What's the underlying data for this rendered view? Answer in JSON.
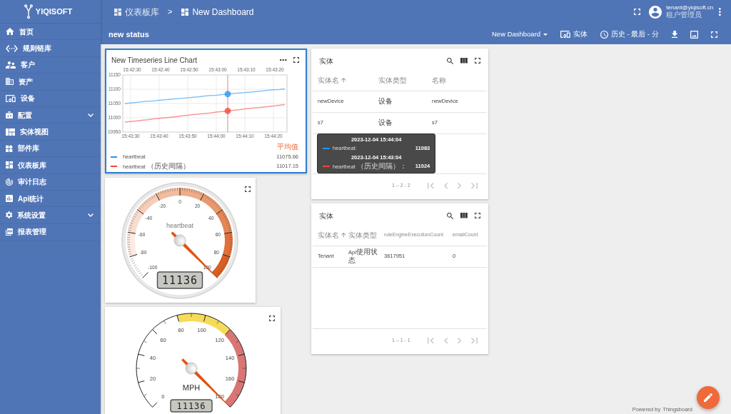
{
  "sidebar": {
    "logo": "YIQISOFT",
    "items": [
      {
        "label": "首页",
        "has_submenu": false
      },
      {
        "label": "规则链库",
        "has_submenu": false
      },
      {
        "label": "客户",
        "has_submenu": false
      },
      {
        "label": "资产",
        "has_submenu": false
      },
      {
        "label": "设备",
        "has_submenu": false
      },
      {
        "label": "配置",
        "has_submenu": true
      },
      {
        "label": "实体视图",
        "has_submenu": false
      },
      {
        "label": "部件库",
        "has_submenu": false
      },
      {
        "label": "仪表板库",
        "has_submenu": false
      },
      {
        "label": "审计日志",
        "has_submenu": false
      },
      {
        "label": "Api统计",
        "has_submenu": false
      },
      {
        "label": "系统设置",
        "has_submenu": true
      },
      {
        "label": "报表管理",
        "has_submenu": false
      }
    ]
  },
  "topbar": {
    "breadcrumb": [
      {
        "label": "仪表板库"
      },
      {
        "label": "New Dashboard"
      }
    ],
    "separator": ">",
    "user": {
      "email": "tenant@yiqisoft.cn",
      "role": "租户管理员"
    }
  },
  "toolbar": {
    "title": "new status",
    "dashboard_select": "New Dashboard",
    "entities_button": "实体",
    "timewindow": "历史 - 最后 - 分"
  },
  "columns": [
    {
      "widgets": [
        {
          "kind": "timeseries_chart",
          "selected": true,
          "title": "New Timeseries Line Chart",
          "top_axis_labels": [
            "15:42:30",
            "15:42:40",
            "15:42:50",
            "15:43:00",
            "15:43:10",
            "15:43:20"
          ],
          "chart_data": {
            "type": "line",
            "grid": true,
            "categories": [
              null,
              "15:43:30",
              null,
              null,
              null,
              null,
              "15:43:40",
              null,
              null,
              null,
              null,
              "15:43:50",
              null,
              null,
              null,
              null,
              "15:44:00",
              null,
              null,
              null,
              null,
              "15:44:10",
              null,
              null,
              null,
              null,
              "15:44:20",
              null,
              null
            ],
            "series": [
              {
                "name": "heartbeat",
                "color": "#2196f3",
                "values": [
                  11050,
                  11052,
                  11054,
                  11056,
                  11058,
                  11059,
                  11061,
                  11063,
                  11065,
                  11067,
                  11068,
                  11070,
                  11072,
                  11074,
                  11076,
                  11078,
                  11079,
                  11081,
                  11083,
                  11085,
                  11087,
                  11088,
                  11090,
                  11092,
                  11094,
                  11096,
                  11098,
                  11099,
                  11101
                ]
              },
              {
                "name": "heartbeat （历史间隔）",
                "color": "#f44336",
                "values": [
                  10985,
                  10987,
                  10989,
                  10991,
                  10993,
                  10996,
                  10998,
                  11000,
                  11002,
                  11004,
                  11007,
                  11009,
                  11011,
                  11013,
                  11015,
                  11017,
                  11020,
                  11022,
                  11024,
                  11026,
                  11028,
                  11031,
                  11033,
                  11035,
                  11037,
                  11039,
                  11041,
                  11044,
                  11046
                ]
              }
            ],
            "ylim": [
              10950,
              11150
            ],
            "yticks": [
              10950,
              11000,
              11050,
              11100,
              11150
            ]
          },
          "tooltip": {
            "entries": [
              {
                "time": "2023-12-04 15:44:04",
                "label": "heartbeat:",
                "value": "11083"
              },
              {
                "time": "2023-12-04 15:43:04",
                "label": "heartbeat （历史间隔）：",
                "value": "11024"
              }
            ]
          },
          "legend": {
            "header": "平均值",
            "values": [
              "11075.66",
              "11017.15"
            ]
          }
        },
        {
          "kind": "radial_gauge",
          "selected": false,
          "title": "heartbeat",
          "value": "11136",
          "level": 1,
          "ticks": [
            {
              "label": "-100"
            },
            {
              "label": "-80",
              "color": "#fbebe3"
            },
            {
              "label": "-60",
              "color": "#f8ddcf"
            },
            {
              "label": "-40",
              "color": "#f5cdb9"
            },
            {
              "label": "-20",
              "color": "#f1bd9f"
            },
            {
              "label": "0",
              "color": "#edab87"
            },
            {
              "label": "20",
              "color": "#e9996e"
            },
            {
              "label": "40",
              "color": "#e58555"
            },
            {
              "label": "60",
              "color": "#e0713a"
            },
            {
              "label": "80",
              "color": "#da5f22"
            },
            {
              "label": "100"
            }
          ]
        },
        {
          "kind": "speed_gauge",
          "selected": false,
          "title": "MPH",
          "value": "11136",
          "level": 1,
          "ticks": [
            {
              "label": "0"
            },
            {
              "label": "20"
            },
            {
              "label": "40"
            },
            {
              "label": "60"
            },
            {
              "label": "80",
              "color": "#f6db58"
            },
            {
              "label": "100",
              "color": "#f6db58"
            },
            {
              "label": "120",
              "color": "#d87674"
            },
            {
              "label": "140",
              "color": "#d87674"
            },
            {
              "label": "160",
              "color": "#d87674"
            },
            {
              "label": "180"
            }
          ]
        }
      ]
    },
    {
      "widgets": [
        {
          "kind": "entity_table",
          "selected": false,
          "title": "实体",
          "columns": [
            {
              "label": "实体名",
              "sorted": true
            },
            {
              "label": "实体类型",
              "sorted": false
            },
            {
              "label": "名称",
              "sorted": false
            }
          ],
          "rows": [
            [
              "newDevice",
              "设备",
              "newDevice"
            ],
            [
              "s7",
              "设备",
              "s7"
            ]
          ],
          "pagination": "1 – 2 - 2",
          "pager_disabled": true
        },
        {
          "kind": "entity_table",
          "selected": false,
          "title": "实体",
          "columns": [
            {
              "label": "实体名",
              "sorted": true
            },
            {
              "label": "实体类型",
              "sorted": false
            },
            {
              "label": "ruleEngineExecutionCount",
              "sorted": false
            },
            {
              "label": "emailCount",
              "sorted": false
            }
          ],
          "rows": [
            [
              "Tenant",
              "Api使用状态",
              "3617951",
              "0"
            ]
          ],
          "pagination": "1 – 1 - 1",
          "pager_disabled": true
        }
      ]
    }
  ],
  "footer": {
    "text": "Powered by",
    "link": "Thingsboard"
  }
}
